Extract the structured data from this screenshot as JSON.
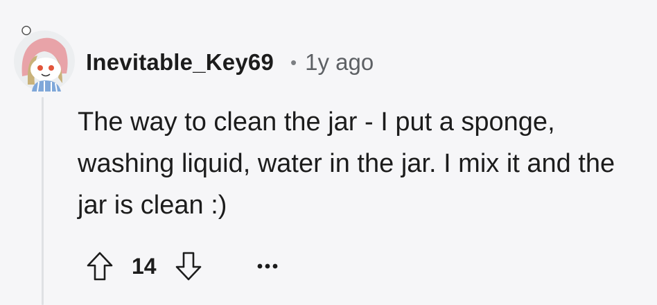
{
  "comment": {
    "author": "Inevitable_Key69",
    "separator": "•",
    "timestamp": "1y ago",
    "body": "The way to clean the jar - I put a sponge, washing liquid, water in the jar. I mix it and the jar is clean :)",
    "score": "14"
  },
  "icons": {
    "upvote": "arrow-up-outline-icon",
    "downvote": "arrow-down-outline-icon",
    "more": "ellipsis-horizontal-icon",
    "avatar": "snoo-avatar-pink-hood"
  },
  "colors": {
    "background": "#f6f6f8",
    "text": "#1c1c1c",
    "muted": "#5d6064",
    "icon": "#1c1c1c",
    "thread_line": "#dfe1e4",
    "avatar_hood": "#e8a3a8",
    "avatar_bg": "#eceef0"
  }
}
